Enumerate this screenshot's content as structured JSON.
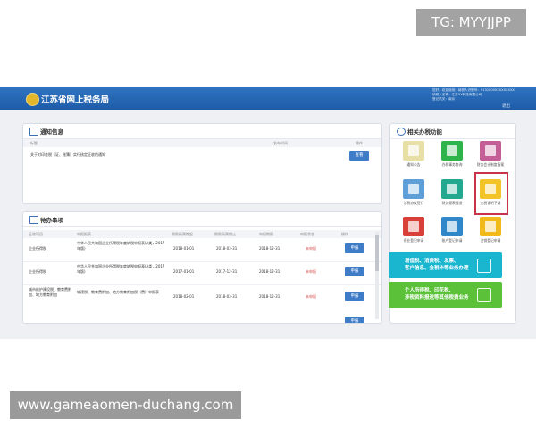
{
  "watermarks": {
    "top": "TG: MYYJJPP",
    "bottom": "www.gameaomen-duchang.com"
  },
  "header": {
    "title": "江苏省网上税务局",
    "user_lines": [
      "您好，欢迎使用！纳税人识别号：91320000XXXXXXXX",
      "纳税人名称：江苏XX科技有限公司",
      "登记机关：南京"
    ],
    "exit_label": "退出"
  },
  "notice": {
    "title": "通知信息",
    "columns": [
      "标题",
      "发布时间",
      "操作"
    ],
    "item_text": "关于对印花税（证、账簿）实行核定征收的通知",
    "item_button": "查看"
  },
  "todo": {
    "title": "待办事项",
    "columns": [
      "征收项目",
      "申报报表",
      "税款所属期起",
      "税款所属期止",
      "申报期限",
      "申报状态",
      "操作"
    ],
    "rows": [
      {
        "item": "企业所得税",
        "report": "中华人民共和国企业所得税年度纳税申报表(A类，2017年版)",
        "start": "2018-01-01",
        "end": "2018-03-31",
        "deadline": "2018-12-31",
        "status": "未申报",
        "action": "申报"
      },
      {
        "item": "企业所得税",
        "report": "中华人民共和国企业所得税年度纳税申报表(A类，2017年版)",
        "start": "2017-01-01",
        "end": "2017-12-31",
        "deadline": "2018-12-31",
        "status": "未申报",
        "action": "申报"
      },
      {
        "item": "城市维护建设税、教育费附加、地方教育附加",
        "report": "城建税、教育费附加、地方教育附加税（费）申报表",
        "start": "2018-02-01",
        "end": "2018-03-31",
        "deadline": "2018-12-31",
        "status": "未申报",
        "action": "申报"
      },
      {
        "item": "",
        "report": "",
        "start": "",
        "end": "",
        "deadline": "",
        "status": "",
        "action": "申报"
      }
    ]
  },
  "functions": {
    "title": "相关办税功能",
    "tiles": [
      {
        "label": "通知公告",
        "color": "#e7dfa6",
        "icon": "bulletin-icon"
      },
      {
        "label": "办税事务查询",
        "color": "#2fb34b",
        "icon": "query-icon"
      },
      {
        "label": "财务会计制度备案",
        "color": "#c35e97",
        "icon": "finance-icon"
      },
      {
        "label": "涉税协议签订",
        "color": "#5e9fd8",
        "icon": "agreement-icon"
      },
      {
        "label": "财务报表报送",
        "color": "#23a98f",
        "icon": "report-icon"
      },
      {
        "label": "完税证明下载",
        "color": "#f2c42a",
        "icon": "certificate-icon"
      },
      {
        "label": "停业登记申请",
        "color": "#d9403a",
        "icon": "suspend-icon"
      },
      {
        "label": "账户登记申请",
        "color": "#2f86c9",
        "icon": "account-icon"
      },
      {
        "label": "注销登记申请",
        "color": "#f1b91a",
        "icon": "cancel-icon"
      }
    ],
    "banners": [
      {
        "text_lines": [
          "增值税、消费税、发票、",
          "客户信息、金税卡等业务办理"
        ],
        "color": "#1ab6cf",
        "icon": "invoice-icon"
      },
      {
        "text_lines": [
          "个人所得税、印花税、",
          "涉税资料报送等其他税费业务"
        ],
        "color": "#5ac139",
        "icon": "personal-tax-icon"
      }
    ]
  }
}
